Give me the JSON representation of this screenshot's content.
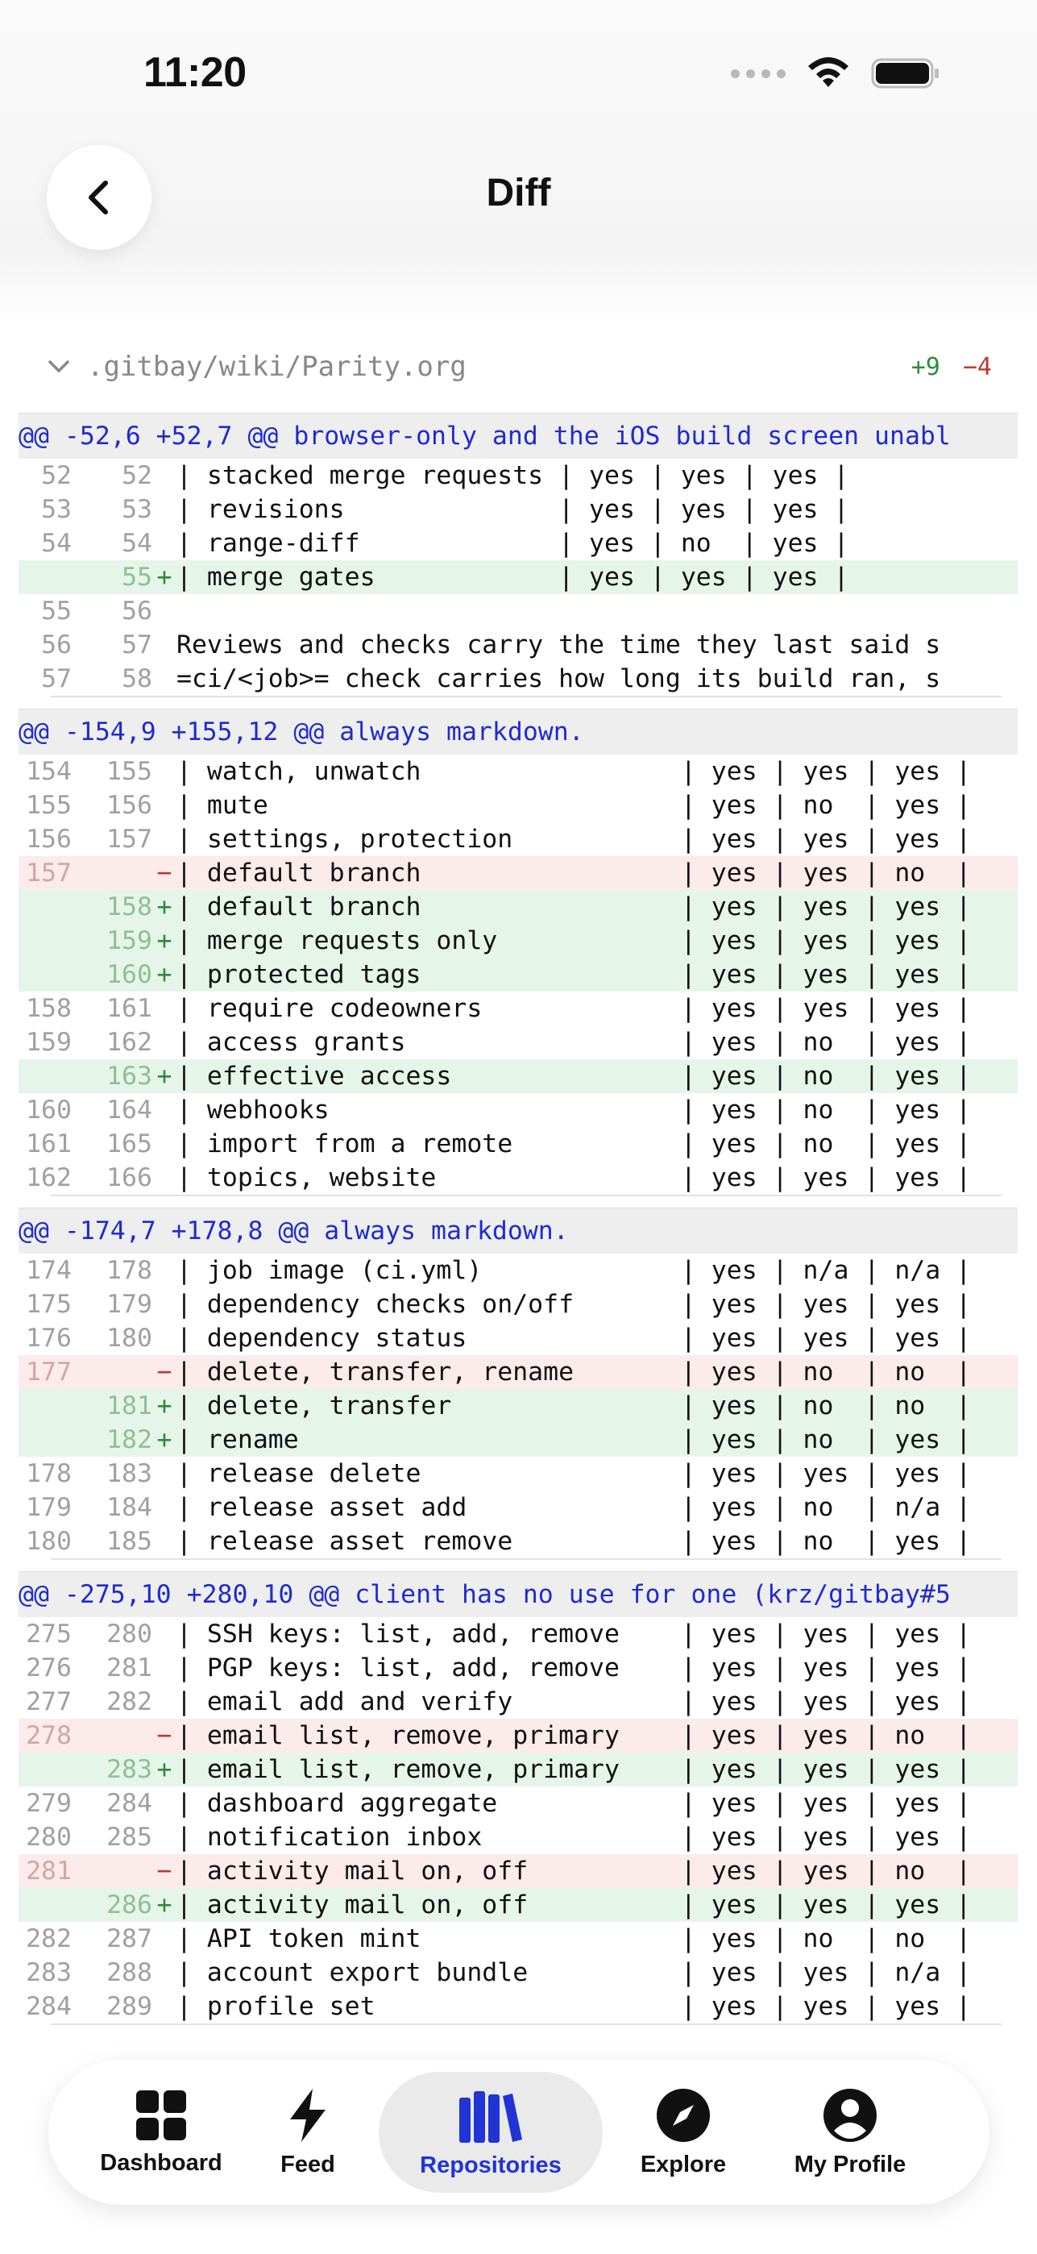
{
  "status_bar": {
    "time": "11:20"
  },
  "header": {
    "title": "Diff"
  },
  "file": {
    "path": ".gitbay/wiki/Parity.org",
    "additions": "+9",
    "deletions": "−4"
  },
  "hunks": [
    {
      "header": "@@ -52,6 +52,7 @@ browser-only and the iOS build screen unabl",
      "lines": [
        {
          "type": "ctx",
          "old": "52",
          "new": "52",
          "text": "| stacked merge requests | yes | yes | yes |"
        },
        {
          "type": "ctx",
          "old": "53",
          "new": "53",
          "text": "| revisions              | yes | yes | yes |"
        },
        {
          "type": "ctx",
          "old": "54",
          "new": "54",
          "text": "| range-diff             | yes | no  | yes |"
        },
        {
          "type": "add",
          "old": "",
          "new": "55",
          "text": "| merge gates            | yes | yes | yes |"
        },
        {
          "type": "ctx",
          "old": "55",
          "new": "56",
          "text": ""
        },
        {
          "type": "ctx",
          "old": "56",
          "new": "57",
          "text": "Reviews and checks carry the time they last said s"
        },
        {
          "type": "ctx",
          "old": "57",
          "new": "58",
          "text": "=ci/<job>= check carries how long its build ran, s"
        }
      ]
    },
    {
      "header": "@@ -154,9 +155,12 @@ always markdown.",
      "lines": [
        {
          "type": "ctx",
          "old": "154",
          "new": "155",
          "text": "| watch, unwatch                 | yes | yes | yes |"
        },
        {
          "type": "ctx",
          "old": "155",
          "new": "156",
          "text": "| mute                           | yes | no  | yes |"
        },
        {
          "type": "ctx",
          "old": "156",
          "new": "157",
          "text": "| settings, protection           | yes | yes | yes |"
        },
        {
          "type": "del",
          "old": "157",
          "new": "",
          "text": "| default branch                 | yes | yes | no  |"
        },
        {
          "type": "add",
          "old": "",
          "new": "158",
          "text": "| default branch                 | yes | yes | yes |"
        },
        {
          "type": "add",
          "old": "",
          "new": "159",
          "text": "| merge requests only            | yes | yes | yes |"
        },
        {
          "type": "add",
          "old": "",
          "new": "160",
          "text": "| protected tags                 | yes | yes | yes |"
        },
        {
          "type": "ctx",
          "old": "158",
          "new": "161",
          "text": "| require codeowners             | yes | yes | yes |"
        },
        {
          "type": "ctx",
          "old": "159",
          "new": "162",
          "text": "| access grants                  | yes | no  | yes |"
        },
        {
          "type": "add",
          "old": "",
          "new": "163",
          "text": "| effective access               | yes | no  | yes |"
        },
        {
          "type": "ctx",
          "old": "160",
          "new": "164",
          "text": "| webhooks                       | yes | no  | yes |"
        },
        {
          "type": "ctx",
          "old": "161",
          "new": "165",
          "text": "| import from a remote           | yes | no  | yes |"
        },
        {
          "type": "ctx",
          "old": "162",
          "new": "166",
          "text": "| topics, website                | yes | yes | yes |"
        }
      ]
    },
    {
      "header": "@@ -174,7 +178,8 @@ always markdown.",
      "lines": [
        {
          "type": "ctx",
          "old": "174",
          "new": "178",
          "text": "| job image (ci.yml)             | yes | n/a | n/a |"
        },
        {
          "type": "ctx",
          "old": "175",
          "new": "179",
          "text": "| dependency checks on/off       | yes | yes | yes |"
        },
        {
          "type": "ctx",
          "old": "176",
          "new": "180",
          "text": "| dependency status              | yes | yes | yes |"
        },
        {
          "type": "del",
          "old": "177",
          "new": "",
          "text": "| delete, transfer, rename       | yes | no  | no  |"
        },
        {
          "type": "add",
          "old": "",
          "new": "181",
          "text": "| delete, transfer               | yes | no  | no  |"
        },
        {
          "type": "add",
          "old": "",
          "new": "182",
          "text": "| rename                         | yes | no  | yes |"
        },
        {
          "type": "ctx",
          "old": "178",
          "new": "183",
          "text": "| release delete                 | yes | yes | yes |"
        },
        {
          "type": "ctx",
          "old": "179",
          "new": "184",
          "text": "| release asset add              | yes | no  | n/a |"
        },
        {
          "type": "ctx",
          "old": "180",
          "new": "185",
          "text": "| release asset remove           | yes | no  | yes |"
        }
      ]
    },
    {
      "header": "@@ -275,10 +280,10 @@ client has no use for one (krz/gitbay#5",
      "lines": [
        {
          "type": "ctx",
          "old": "275",
          "new": "280",
          "text": "| SSH keys: list, add, remove    | yes | yes | yes |"
        },
        {
          "type": "ctx",
          "old": "276",
          "new": "281",
          "text": "| PGP keys: list, add, remove    | yes | yes | yes |"
        },
        {
          "type": "ctx",
          "old": "277",
          "new": "282",
          "text": "| email add and verify           | yes | yes | yes |"
        },
        {
          "type": "del",
          "old": "278",
          "new": "",
          "text": "| email list, remove, primary    | yes | yes | no  |"
        },
        {
          "type": "add",
          "old": "",
          "new": "283",
          "text": "| email list, remove, primary    | yes | yes | yes |"
        },
        {
          "type": "ctx",
          "old": "279",
          "new": "284",
          "text": "| dashboard aggregate            | yes | yes | yes |"
        },
        {
          "type": "ctx",
          "old": "280",
          "new": "285",
          "text": "| notification inbox             | yes | yes | yes |"
        },
        {
          "type": "del",
          "old": "281",
          "new": "",
          "text": "| activity mail on, off          | yes | yes | no  |"
        },
        {
          "type": "add",
          "old": "",
          "new": "286",
          "text": "| activity mail on, off          | yes | yes | yes |"
        },
        {
          "type": "ctx",
          "old": "282",
          "new": "287",
          "text": "| API token mint                 | yes | no  | no  |"
        },
        {
          "type": "ctx",
          "old": "283",
          "new": "288",
          "text": "| account export bundle          | yes | yes | n/a |"
        },
        {
          "type": "ctx",
          "old": "284",
          "new": "289",
          "text": "| profile set                    | yes | yes | yes |"
        }
      ]
    }
  ],
  "tabbar": {
    "items": [
      {
        "label": "Dashboard",
        "icon": "dashboard-icon",
        "active": false
      },
      {
        "label": "Feed",
        "icon": "bolt-icon",
        "active": false
      },
      {
        "label": "Repositories",
        "icon": "repositories-icon",
        "active": true
      },
      {
        "label": "Explore",
        "icon": "compass-icon",
        "active": false
      },
      {
        "label": "My Profile",
        "icon": "profile-icon",
        "active": false
      }
    ]
  },
  "colors": {
    "accent": "#2134d6",
    "add": "#2e8b3a",
    "del": "#c0392b",
    "add_bg": "#e6f5e9",
    "del_bg": "#fcebeb",
    "hunk_text": "#1f2bd1"
  }
}
